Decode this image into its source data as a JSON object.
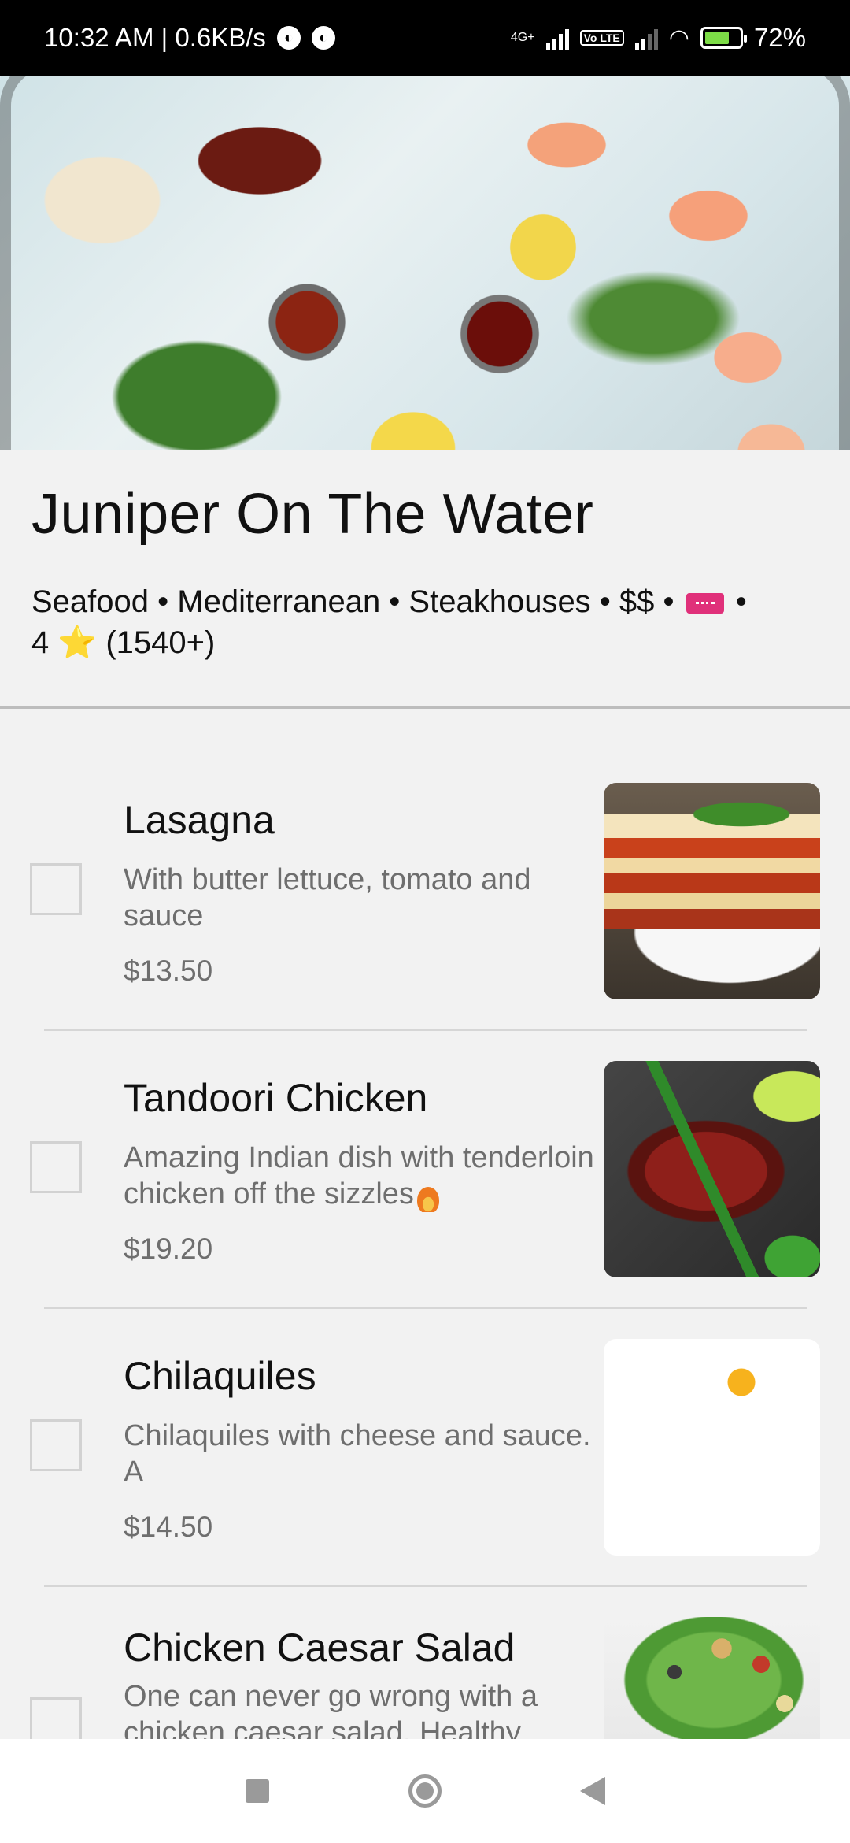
{
  "status_bar": {
    "time_speed": "10:32 AM | 0.6KB/s",
    "network": "4G+",
    "volte": "Vo LTE",
    "battery": "72%",
    "battery_level": 0.72
  },
  "restaurant": {
    "name": "Juniper On The Water",
    "categories": "Seafood • Mediterranean • Steakhouses  • $$ •",
    "rating_sep": "•",
    "rating": "4",
    "star": "⭐",
    "reviews": "(1540+)"
  },
  "menu": [
    {
      "name": "Lasagna",
      "description": "With butter lettuce, tomato and sauce\nbechamel",
      "price": "$13.50"
    },
    {
      "name": "Tandoori Chicken",
      "description": "Amazing Indian dish with tenderloin\nchicken off the sizzles",
      "price": "$19.20"
    },
    {
      "name": "Chilaquiles",
      "description": "Chilaquiles with cheese and sauce. A\ndelicious mexican dish",
      "price": "$14.50"
    },
    {
      "name": "Chicken Caesar Salad",
      "description": "One can never go wrong with a\nchicken caesar salad. Healthy option",
      "price": ""
    }
  ],
  "icons": {
    "ticket": "ticket-icon",
    "fire": "fire-emoji",
    "flag": "mexico-flag-emoji"
  },
  "colors": {
    "ticket": "#e0307a",
    "star": "#f6c21b"
  }
}
